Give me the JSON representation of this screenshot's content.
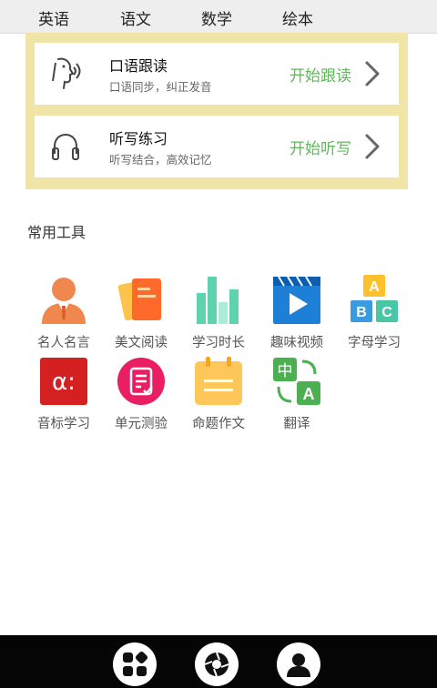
{
  "tabs": [
    {
      "label": "英语"
    },
    {
      "label": "语文"
    },
    {
      "label": "数学"
    },
    {
      "label": "绘本"
    }
  ],
  "cards": [
    {
      "title": "口语跟读",
      "subtitle": "口语同步，纠正发音",
      "action": "开始跟读",
      "icon": "speaking-head-icon"
    },
    {
      "title": "听写练习",
      "subtitle": "听写结合，高效记忆",
      "action": "开始听写",
      "icon": "headphones-icon"
    }
  ],
  "tools_title": "常用工具",
  "tools": [
    {
      "label": "名人名言",
      "icon": "person-icon"
    },
    {
      "label": "美文阅读",
      "icon": "article-icon"
    },
    {
      "label": "学习时长",
      "icon": "bar-chart-icon"
    },
    {
      "label": "趣味视频",
      "icon": "video-icon"
    },
    {
      "label": "字母学习",
      "icon": "abc-blocks-icon"
    },
    {
      "label": "音标学习",
      "icon": "phonetic-icon"
    },
    {
      "label": "单元测验",
      "icon": "quiz-icon"
    },
    {
      "label": "命题作文",
      "icon": "calendar-note-icon"
    },
    {
      "label": "翻译",
      "icon": "translate-icon"
    }
  ],
  "bottom_nav": [
    {
      "name": "apps-icon"
    },
    {
      "name": "explore-icon"
    },
    {
      "name": "profile-icon"
    }
  ],
  "colors": {
    "panel": "#f0e5a6",
    "action_green": "#5fb85a",
    "bottom_bar": "#050505"
  }
}
